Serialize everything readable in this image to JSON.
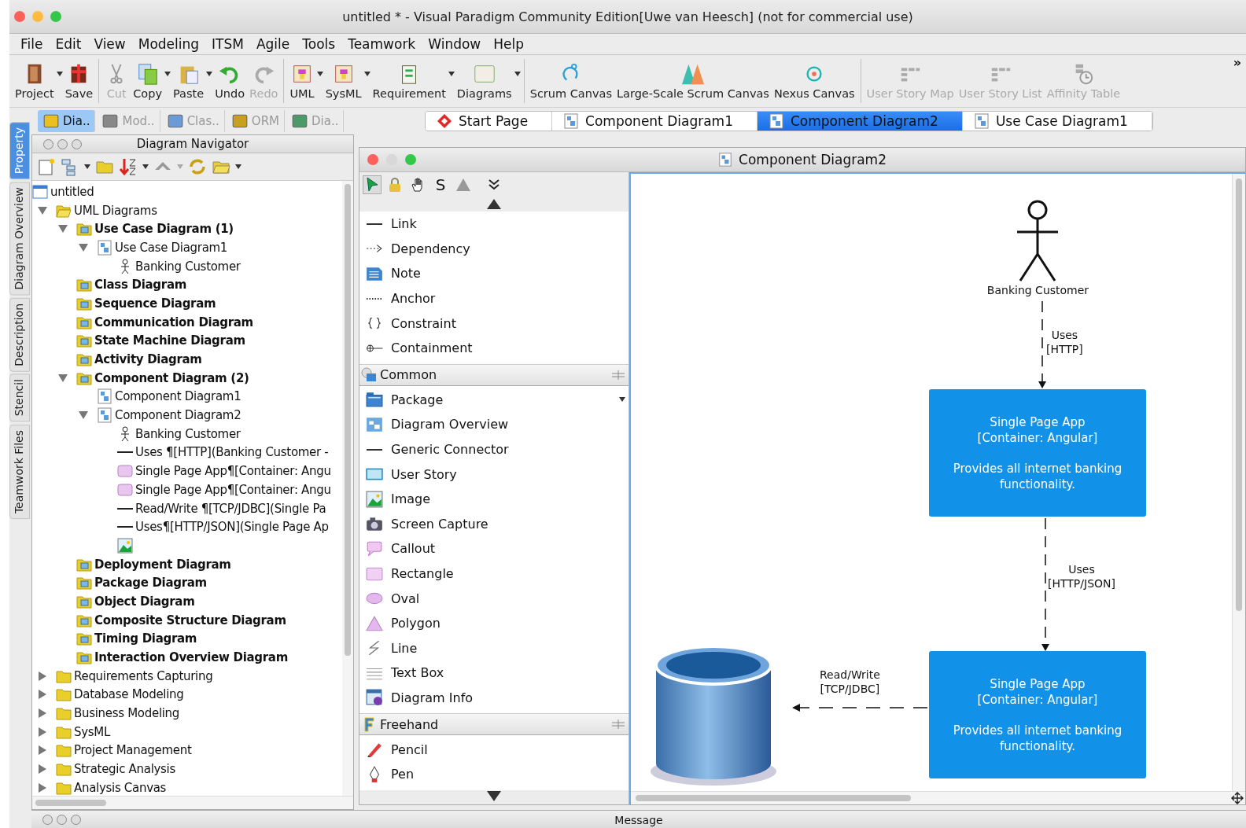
{
  "window": {
    "title": "untitled * - Visual Paradigm Community Edition[Uwe van Heesch] (not for commercial use)"
  },
  "menu": [
    "File",
    "Edit",
    "View",
    "Modeling",
    "ITSM",
    "Agile",
    "Tools",
    "Teamwork",
    "Window",
    "Help"
  ],
  "toolbar": {
    "groups": [
      [
        {
          "label": "Project",
          "disabled": false,
          "dropdown": true
        },
        {
          "label": "Save",
          "disabled": false,
          "dropdown": false
        }
      ],
      [
        {
          "label": "Cut",
          "disabled": true,
          "dropdown": false
        },
        {
          "label": "Copy",
          "disabled": false,
          "dropdown": true
        },
        {
          "label": "Paste",
          "disabled": false,
          "dropdown": true
        },
        {
          "label": "Undo",
          "disabled": false,
          "dropdown": false
        },
        {
          "label": "Redo",
          "disabled": true,
          "dropdown": false
        }
      ],
      [
        {
          "label": "UML",
          "disabled": false,
          "dropdown": true
        },
        {
          "label": "SysML",
          "disabled": false,
          "dropdown": true
        },
        {
          "label": "Requirement",
          "disabled": false,
          "dropdown": true
        },
        {
          "label": "Diagrams",
          "disabled": false,
          "dropdown": true
        }
      ],
      [
        {
          "label": "Scrum Canvas",
          "disabled": false,
          "dropdown": false
        },
        {
          "label": "Large-Scale Scrum Canvas",
          "disabled": false,
          "dropdown": false
        },
        {
          "label": "Nexus Canvas",
          "disabled": false,
          "dropdown": false
        }
      ],
      [
        {
          "label": "User Story Map",
          "disabled": true,
          "dropdown": false
        },
        {
          "label": "User Story List",
          "disabled": true,
          "dropdown": false
        },
        {
          "label": "Affinity Table",
          "disabled": true,
          "dropdown": false
        }
      ]
    ],
    "overflow": "»"
  },
  "side_tabs": [
    {
      "label": "Property",
      "selected": true
    },
    {
      "label": "Diagram Overview",
      "selected": false
    },
    {
      "label": "Description",
      "selected": false
    },
    {
      "label": "Stencil",
      "selected": false
    },
    {
      "label": "Teamwork Files",
      "selected": false
    }
  ],
  "left_tabs": [
    {
      "label": "Dia..",
      "selected": true
    },
    {
      "label": "Mod..",
      "selected": false
    },
    {
      "label": "Clas..",
      "selected": false
    },
    {
      "label": "ORM",
      "selected": false
    },
    {
      "label": "Dia..",
      "selected": false
    }
  ],
  "navigator": {
    "title": "Diagram Navigator",
    "tree": [
      {
        "label": "untitled",
        "kind": "project",
        "bold": false,
        "children": [
          {
            "label": "UML Diagrams",
            "kind": "folder-open",
            "bold": false,
            "expanded": true,
            "children": [
              {
                "label": "Use Case Diagram (1)",
                "kind": "diagram-folder",
                "bold": true,
                "expanded": true,
                "children": [
                  {
                    "label": "Use Case Diagram1",
                    "kind": "diagram",
                    "bold": false,
                    "expanded": true,
                    "children": [
                      {
                        "label": "Banking Customer",
                        "kind": "actor",
                        "bold": false
                      }
                    ]
                  }
                ]
              },
              {
                "label": "Class Diagram",
                "kind": "diagram-folder",
                "bold": true
              },
              {
                "label": "Sequence Diagram",
                "kind": "diagram-folder",
                "bold": true
              },
              {
                "label": "Communication Diagram",
                "kind": "diagram-folder",
                "bold": true
              },
              {
                "label": "State Machine Diagram",
                "kind": "diagram-folder",
                "bold": true
              },
              {
                "label": "Activity Diagram",
                "kind": "diagram-folder",
                "bold": true
              },
              {
                "label": "Component Diagram (2)",
                "kind": "diagram-folder",
                "bold": true,
                "expanded": true,
                "children": [
                  {
                    "label": "Component Diagram1",
                    "kind": "diagram",
                    "bold": false
                  },
                  {
                    "label": "Component Diagram2",
                    "kind": "diagram",
                    "bold": false,
                    "expanded": true,
                    "children": [
                      {
                        "label": "Banking Customer",
                        "kind": "actor",
                        "bold": false
                      },
                      {
                        "label": "Uses ¶[HTTP](Banking Customer -",
                        "kind": "connector",
                        "bold": false
                      },
                      {
                        "label": "Single Page App¶[Container: Angu",
                        "kind": "shape",
                        "bold": false
                      },
                      {
                        "label": "Single Page App¶[Container: Angu",
                        "kind": "shape",
                        "bold": false
                      },
                      {
                        "label": "Read/Write ¶[TCP/JDBC](Single Pa",
                        "kind": "connector",
                        "bold": false
                      },
                      {
                        "label": "Uses¶[HTTP/JSON](Single Page Ap",
                        "kind": "connector",
                        "bold": false
                      },
                      {
                        "kind": "image"
                      }
                    ]
                  }
                ]
              },
              {
                "label": "Deployment Diagram",
                "kind": "diagram-folder",
                "bold": true
              },
              {
                "label": "Package Diagram",
                "kind": "diagram-folder",
                "bold": true
              },
              {
                "label": "Object Diagram",
                "kind": "diagram-folder",
                "bold": true
              },
              {
                "label": "Composite Structure Diagram",
                "kind": "diagram-folder",
                "bold": true
              },
              {
                "label": "Timing Diagram",
                "kind": "diagram-folder",
                "bold": true
              },
              {
                "label": "Interaction Overview Diagram",
                "kind": "diagram-folder",
                "bold": true
              }
            ]
          },
          {
            "label": "Requirements Capturing",
            "kind": "folder",
            "bold": false,
            "expanded": false
          },
          {
            "label": "Database Modeling",
            "kind": "folder",
            "bold": false,
            "expanded": false
          },
          {
            "label": "Business Modeling",
            "kind": "folder",
            "bold": false,
            "expanded": false
          },
          {
            "label": "SysML",
            "kind": "folder",
            "bold": false,
            "expanded": false
          },
          {
            "label": "Project Management",
            "kind": "folder",
            "bold": false,
            "expanded": false
          },
          {
            "label": "Strategic Analysis",
            "kind": "folder",
            "bold": false,
            "expanded": false
          },
          {
            "label": "Analysis Canvas",
            "kind": "folder",
            "bold": false,
            "expanded": false
          }
        ]
      }
    ]
  },
  "editor_tabs": [
    {
      "label": "Start Page",
      "selected": false
    },
    {
      "label": "Component Diagram1",
      "selected": false
    },
    {
      "label": "Component Diagram2",
      "selected": true
    },
    {
      "label": "Use Case Diagram1",
      "selected": false
    }
  ],
  "diagram_window": {
    "title": "Component Diagram2",
    "palette": {
      "tools": [
        {
          "kind": "pointer",
          "selected": true
        },
        {
          "kind": "lock",
          "selected": false
        },
        {
          "kind": "hand",
          "selected": false
        },
        {
          "kind": "text",
          "label": "S",
          "selected": false
        },
        {
          "kind": "shape",
          "selected": false
        }
      ],
      "sections": [
        {
          "items": [
            {
              "label": "Link",
              "kind": "line"
            },
            {
              "label": "Dependency",
              "kind": "dep"
            },
            {
              "label": "Note",
              "kind": "note"
            },
            {
              "label": "Anchor",
              "kind": "dots"
            },
            {
              "label": "Constraint",
              "kind": "constraint"
            },
            {
              "label": "Containment",
              "kind": "containment"
            }
          ]
        },
        {
          "title": "Common",
          "items": [
            {
              "label": "Package",
              "kind": "package",
              "dropdown": true
            },
            {
              "label": "Diagram Overview",
              "kind": "overview"
            },
            {
              "label": "Generic Connector",
              "kind": "line"
            },
            {
              "label": "User Story",
              "kind": "story"
            },
            {
              "label": "Image",
              "kind": "image"
            },
            {
              "label": "Screen Capture",
              "kind": "camera"
            },
            {
              "label": "Callout",
              "kind": "callout"
            },
            {
              "label": "Rectangle",
              "kind": "rect"
            },
            {
              "label": "Oval",
              "kind": "oval"
            },
            {
              "label": "Polygon",
              "kind": "polygon"
            },
            {
              "label": "Line",
              "kind": "zigzag"
            },
            {
              "label": "Text Box",
              "kind": "textbox"
            },
            {
              "label": "Diagram Info",
              "kind": "info"
            }
          ]
        },
        {
          "title": "Freehand",
          "items": [
            {
              "label": "Pencil",
              "kind": "pencil"
            },
            {
              "label": "Pen",
              "kind": "pen"
            }
          ]
        }
      ]
    },
    "diagram": {
      "actor": {
        "label": "Banking Customer"
      },
      "containers": [
        {
          "title": "Single Page App",
          "technology": "[Container: Angular]",
          "description": "Provides all internet banking functionality."
        },
        {
          "title": "Single Page App",
          "technology": "[Container: Angular]",
          "description": "Provides all internet banking functionality."
        }
      ],
      "connectors": [
        {
          "lines": [
            "Uses",
            "[HTTP]"
          ]
        },
        {
          "lines": [
            "Uses",
            "[HTTP/JSON]"
          ]
        },
        {
          "lines": [
            "Read/Write",
            "[TCP/JDBC]"
          ]
        }
      ]
    }
  },
  "bottom_panel": {
    "title": "Message"
  }
}
